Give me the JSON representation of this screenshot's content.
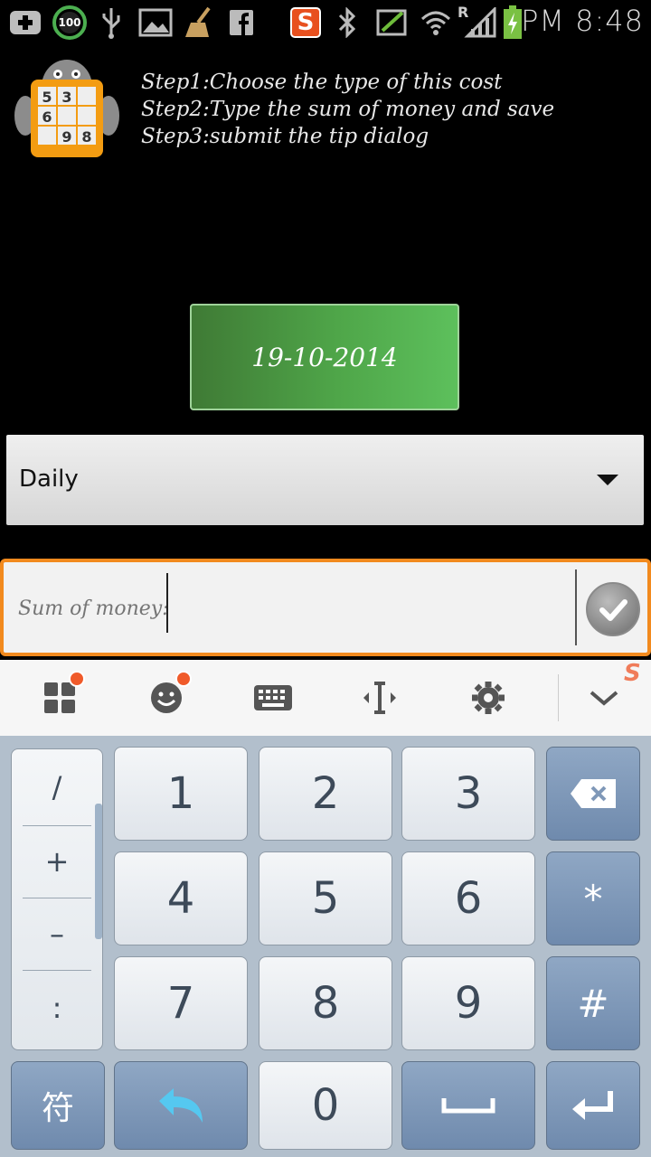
{
  "status_bar": {
    "time": "PM 8:48",
    "battery_badge": "100",
    "signal_roaming": "R",
    "app_badge": "S",
    "icons": [
      "plus-icon",
      "battery-saver-icon",
      "usb-icon",
      "gallery-icon",
      "cleaner-icon",
      "facebook-icon",
      "sogou-icon",
      "bluetooth-icon",
      "no-sim-icon",
      "wifi-icon",
      "signal-icon",
      "battery-icon"
    ]
  },
  "instructions": {
    "step1": "Step1:Choose the type of this cost",
    "step2": "Step2:Type the sum of money and save",
    "step3": "Step3:submit the tip dialog"
  },
  "app_icon": {
    "digits": [
      "5",
      "3",
      "6",
      "9",
      "8"
    ]
  },
  "date_button": {
    "label": "19-10-2014"
  },
  "period_spinner": {
    "selected": "Daily"
  },
  "money_input": {
    "value": "",
    "placeholder": "Sum of money:"
  },
  "keyboard_toolbar": {
    "icons": [
      "apps-grid-icon",
      "emoji-icon",
      "keyboard-icon",
      "cursor-move-icon",
      "settings-gear-icon",
      "collapse-chevron-icon"
    ],
    "brand_badge": "S"
  },
  "keyboard": {
    "side_symbols": [
      "/",
      "+",
      "–",
      ":"
    ],
    "digits": [
      "1",
      "2",
      "3",
      "4",
      "5",
      "6",
      "7",
      "8",
      "9",
      "0"
    ],
    "star": "*",
    "hash": "#",
    "symbol_key": "符"
  },
  "colors": {
    "accent_orange": "#f28a1e",
    "date_green": "#4fa649",
    "keyboard_dark_key": "#7f98b8",
    "keyboard_bg": "#b2bfcc"
  }
}
